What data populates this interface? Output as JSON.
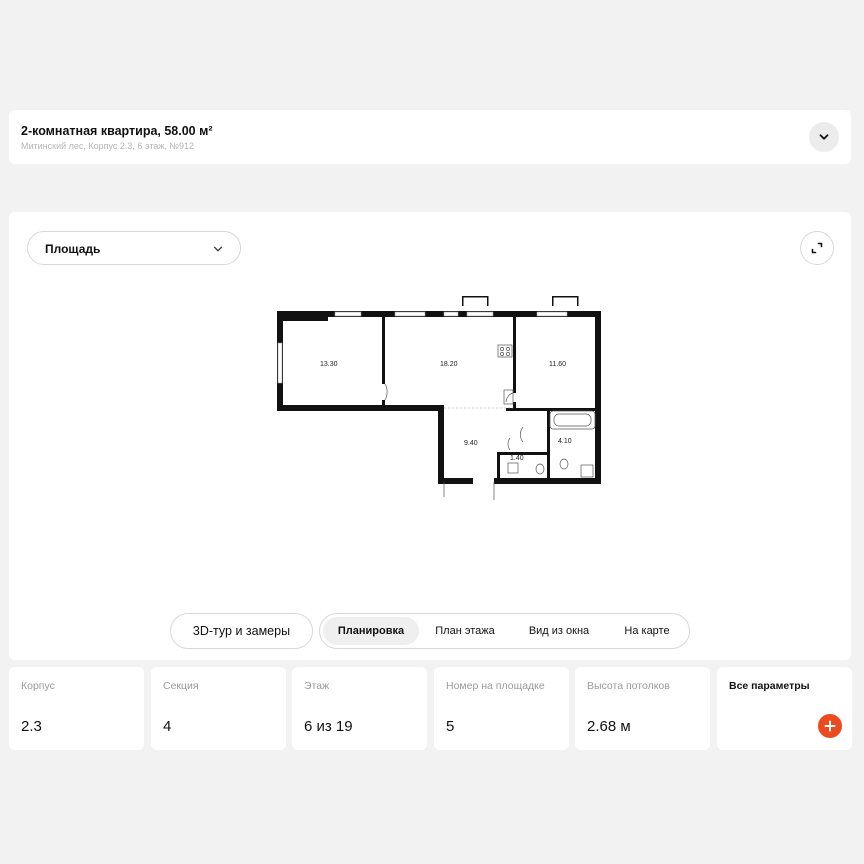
{
  "header": {
    "title": "2-комнатная квартира, 58.00 м²",
    "subtitle": "Митинский лес, Корпус 2.3, 6 этаж, №912"
  },
  "plan": {
    "area_select": "Площадь",
    "rooms": [
      {
        "label": "13.30"
      },
      {
        "label": "18.20"
      },
      {
        "label": "11.60"
      },
      {
        "label": "9.40"
      },
      {
        "label": "1.40"
      },
      {
        "label": "4.10"
      }
    ]
  },
  "actions": {
    "tour": "3D-тур и замеры",
    "tabs": [
      {
        "label": "Планировка",
        "active": true
      },
      {
        "label": "План этажа",
        "active": false
      },
      {
        "label": "Вид из окна",
        "active": false
      },
      {
        "label": "На карте",
        "active": false
      }
    ]
  },
  "stats": [
    {
      "label": "Корпус",
      "value": "2.3"
    },
    {
      "label": "Секция",
      "value": "4"
    },
    {
      "label": "Этаж",
      "value": "6 из 19"
    },
    {
      "label": "Номер на площадке",
      "value": "5"
    },
    {
      "label": "Высота потолков",
      "value": "2.68 м"
    }
  ],
  "all_params": "Все параметры",
  "icons": [
    "chevron-down-icon",
    "expand-icon",
    "plus-icon"
  ],
  "colors": {
    "accent": "#ea4a1e",
    "background": "#f2f2f2",
    "card": "#ffffff"
  }
}
